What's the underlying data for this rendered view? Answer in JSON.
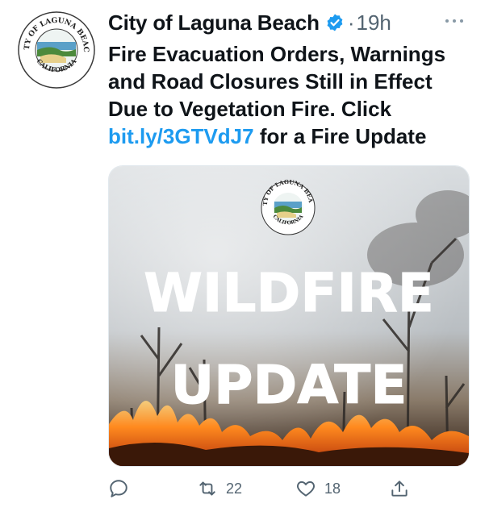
{
  "tweet": {
    "author_name": "City of Laguna Beach",
    "separator": "·",
    "timestamp": "19h",
    "text_before_link": "Fire Evacuation Orders, Warnings and Road Closures Still in Effect Due to Vegetation Fire. Click ",
    "link_text": "bit.ly/3GTVdJ7",
    "text_after_link": " for a Fire Update"
  },
  "media": {
    "headline_line1": "WILDFIRE",
    "headline_line2": "UPDATE",
    "seal_top": "CITY OF LAGUNA BEACH",
    "seal_bottom": "CALIFORNIA"
  },
  "actions": {
    "retweets": "22",
    "likes": "18"
  },
  "colors": {
    "accent": "#1d9bf0",
    "muted": "#536471"
  }
}
